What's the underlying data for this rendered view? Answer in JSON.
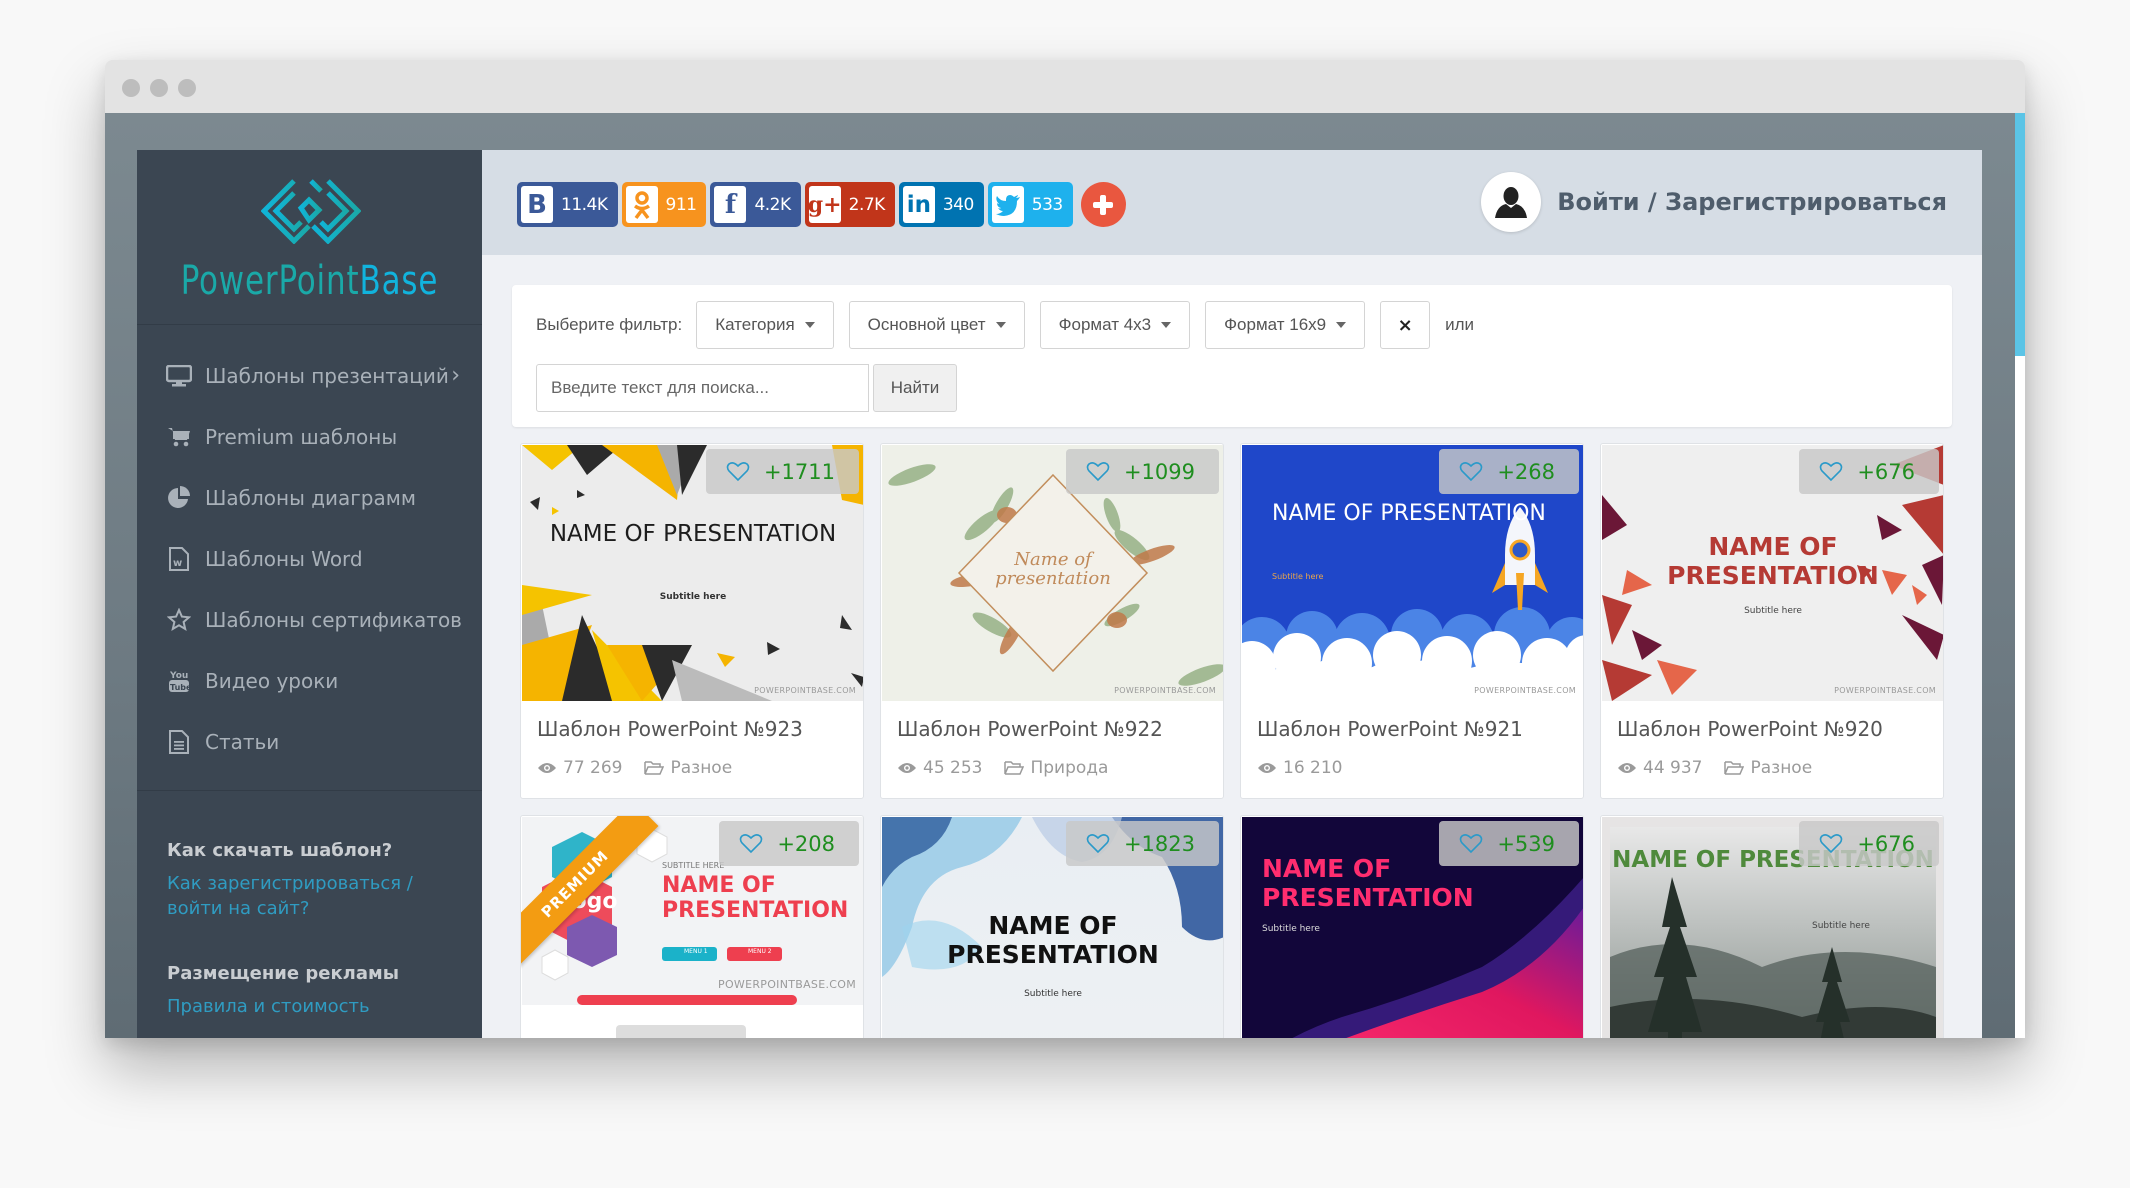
{
  "window": {
    "title_dots": 3
  },
  "brand": {
    "name_part1": "PowerPoint",
    "name_part2": "Base",
    "color_primary": "#1aa9a8",
    "color_secondary": "#11b3dd"
  },
  "sidebar": {
    "items": [
      {
        "label": "Шаблоны презентаций",
        "icon": "monitor-icon",
        "has_submenu": true
      },
      {
        "label": "Premium шаблоны",
        "icon": "cart-icon"
      },
      {
        "label": "Шаблоны диаграмм",
        "icon": "pie-chart-icon"
      },
      {
        "label": "Шаблоны Word",
        "icon": "word-file-icon"
      },
      {
        "label": "Шаблоны сертификатов",
        "icon": "star-icon"
      },
      {
        "label": "Видео уроки",
        "icon": "youtube-icon"
      },
      {
        "label": "Статьи",
        "icon": "document-icon"
      }
    ],
    "info": [
      {
        "heading": "Как скачать шаблон?",
        "link": "Как зарегистрироваться / войти на сайт?"
      },
      {
        "heading": "Размещение рекламы",
        "link": "Правила и стоимость"
      }
    ]
  },
  "header": {
    "social": [
      {
        "network": "vk",
        "glyph": "B",
        "count": "11.4K",
        "color": "#3b5998"
      },
      {
        "network": "odnoklassniki",
        "glyph": "ok",
        "count": "911",
        "color": "#f7931e"
      },
      {
        "network": "facebook",
        "glyph": "f",
        "count": "4.2K",
        "color": "#3b5998"
      },
      {
        "network": "google-plus",
        "glyph": "g+",
        "count": "2.7K",
        "color": "#c1351a"
      },
      {
        "network": "linkedin",
        "glyph": "in",
        "count": "340",
        "color": "#0073b1"
      },
      {
        "network": "twitter",
        "glyph": "t",
        "count": "533",
        "color": "#1eb1ed"
      }
    ],
    "more_color": "#e9573f",
    "login_label": "Войти / Зарегистрироваться"
  },
  "filters": {
    "label": "Выберите фильтр:",
    "dropdowns": [
      "Категория",
      "Основной цвет",
      "Формат 4x3",
      "Формат 16x9"
    ],
    "clear_label": "×",
    "or_label": "или",
    "search_placeholder": "Введите текст для поиска...",
    "search_button": "Найти"
  },
  "cards": [
    {
      "title": "Шаблон PowerPoint №923",
      "likes": "+1711",
      "views": "77 269",
      "category": "Разное",
      "slide_title": "NAME OF PRESENTATION",
      "slide_subtitle": "Subtitle here",
      "premium": false
    },
    {
      "title": "Шаблон PowerPoint №922",
      "likes": "+1099",
      "views": "45 253",
      "category": "Природа",
      "slide_title": "Name of presentation",
      "slide_subtitle": "",
      "premium": false
    },
    {
      "title": "Шаблон PowerPoint №921",
      "likes": "+268",
      "views": "16 210",
      "category": "",
      "slide_title": "NAME OF PRESENTATION",
      "slide_subtitle": "Subtitle here",
      "premium": false
    },
    {
      "title": "Шаблон PowerPoint №920",
      "likes": "+676",
      "views": "44 937",
      "category": "Разное",
      "slide_title": "NAME OF PRESENTATION",
      "slide_subtitle": "Subtitle here",
      "premium": false
    },
    {
      "title": "",
      "likes": "+208",
      "views": "",
      "category": "",
      "slide_title": "NAME OF PRESENTATION",
      "slide_subtitle": "SUBTITLE HERE",
      "premium": true,
      "premium_label": "PREMIUM",
      "logo_text": "logo",
      "menu1": "MENU 1",
      "menu2": "MENU 2"
    },
    {
      "title": "",
      "likes": "+1823",
      "views": "",
      "category": "",
      "slide_title": "NAME OF PRESENTATION",
      "slide_subtitle": "Subtitle here",
      "premium": false
    },
    {
      "title": "",
      "likes": "+539",
      "views": "",
      "category": "",
      "slide_title": "NAME OF PRESENTATION",
      "slide_subtitle": "Subtitle here",
      "premium": false
    },
    {
      "title": "",
      "likes": "+676",
      "views": "",
      "category": "",
      "slide_title": "NAME OF PRESENTATION",
      "slide_subtitle": "Subtitle here",
      "premium": false
    }
  ],
  "watermark": "POWERPOINTBASE.COM"
}
